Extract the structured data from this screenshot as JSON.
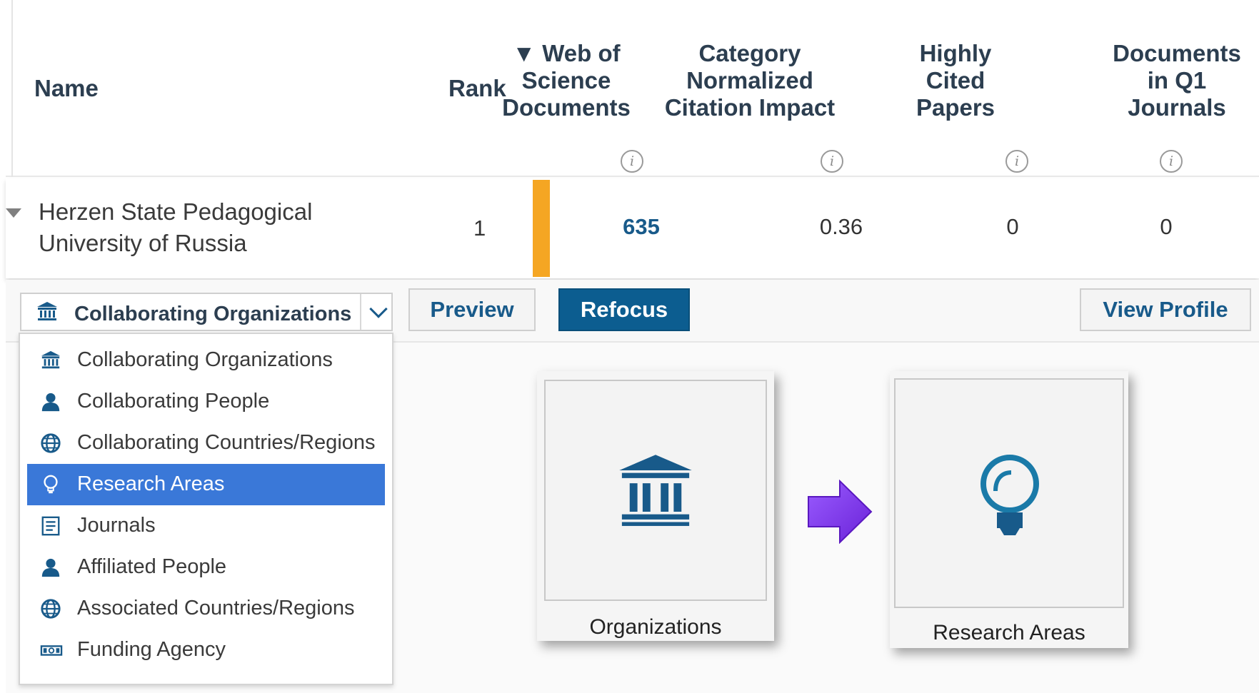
{
  "table": {
    "headers": {
      "name": "Name",
      "rank": "Rank",
      "wos_sort_indicator": "▼",
      "wos_line1": "Web of",
      "wos_line2": "Science",
      "wos_line3": "Documents",
      "cnci_line1": "Category",
      "cnci_line2": "Normalized",
      "cnci_line3": "Citation Impact",
      "hcp_line1": "Highly",
      "hcp_line2": "Cited",
      "hcp_line3": "Papers",
      "q1_line1": "Documents",
      "q1_line2": "in Q1",
      "q1_line3": "Journals",
      "info_glyph": "i"
    },
    "row": {
      "name_line1": "Herzen State Pedagogical",
      "name_line2": "University of Russia",
      "rank": "1",
      "wos_documents": "635",
      "cnci": "0.36",
      "highly_cited_papers": "0",
      "documents_q1": "0",
      "bar_color": "#f5a623"
    }
  },
  "toolbar": {
    "select_value": "Collaborating Organizations",
    "select_icon": "institution-icon",
    "preview_label": "Preview",
    "refocus_label": "Refocus",
    "view_profile_label": "View Profile"
  },
  "menu": {
    "items": [
      {
        "label": "Collaborating Organizations",
        "icon": "institution-icon"
      },
      {
        "label": "Collaborating People",
        "icon": "person-icon"
      },
      {
        "label": "Collaborating Countries/Regions",
        "icon": "globe-icon"
      },
      {
        "label": "Research Areas",
        "icon": "lightbulb-icon",
        "selected": true
      },
      {
        "label": "Journals",
        "icon": "journal-icon"
      },
      {
        "label": "Affiliated People",
        "icon": "person-icon"
      },
      {
        "label": "Associated Countries/Regions",
        "icon": "globe-icon"
      },
      {
        "label": "Funding Agency",
        "icon": "money-icon"
      }
    ]
  },
  "cards": {
    "from_label": "Organizations",
    "from_icon": "institution-icon",
    "to_label": "Research Areas",
    "to_icon": "lightbulb-icon"
  },
  "colors": {
    "brand_blue": "#185a8a",
    "refocus_bg": "#0c5d90",
    "selected_bg": "#3a78d8",
    "arrow_purple": "#8844ee"
  }
}
